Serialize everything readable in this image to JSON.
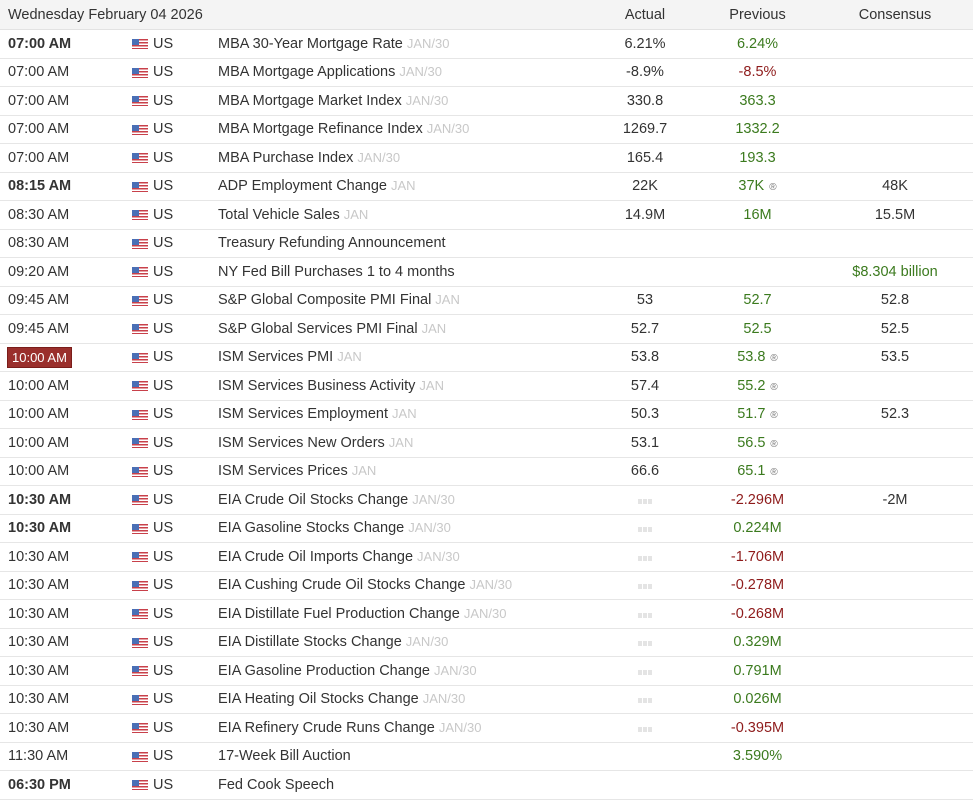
{
  "header": {
    "date": "Wednesday February 04 2026",
    "actual": "Actual",
    "previous": "Previous",
    "consensus": "Consensus"
  },
  "colors": {
    "positive": "#3b7a1e",
    "negative": "#8e1b1b",
    "highlight": "#9a2f2c"
  },
  "revised_icon": "®",
  "rows": [
    {
      "time": "07:00 AM",
      "bold": true,
      "country": "US",
      "event": "MBA 30-Year Mortgage Rate",
      "period": "JAN/30",
      "actual": "6.21%",
      "previous": "6.24%",
      "prev_color": "green",
      "consensus": ""
    },
    {
      "time": "07:00 AM",
      "country": "US",
      "event": "MBA Mortgage Applications",
      "period": "JAN/30",
      "actual": "-8.9%",
      "previous": "-8.5%",
      "prev_color": "red",
      "consensus": ""
    },
    {
      "time": "07:00 AM",
      "country": "US",
      "event": "MBA Mortgage Market Index",
      "period": "JAN/30",
      "actual": "330.8",
      "previous": "363.3",
      "prev_color": "green",
      "consensus": ""
    },
    {
      "time": "07:00 AM",
      "country": "US",
      "event": "MBA Mortgage Refinance Index",
      "period": "JAN/30",
      "actual": "1269.7",
      "previous": "1332.2",
      "prev_color": "green",
      "consensus": ""
    },
    {
      "time": "07:00 AM",
      "country": "US",
      "event": "MBA Purchase Index",
      "period": "JAN/30",
      "actual": "165.4",
      "previous": "193.3",
      "prev_color": "green",
      "consensus": ""
    },
    {
      "time": "08:15 AM",
      "bold": true,
      "country": "US",
      "event": "ADP Employment Change",
      "period": "JAN",
      "actual": "22K",
      "previous": "37K",
      "prev_color": "green",
      "revised": true,
      "consensus": "48K"
    },
    {
      "time": "08:30 AM",
      "country": "US",
      "event": "Total Vehicle Sales",
      "period": "JAN",
      "actual": "14.9M",
      "previous": "16M",
      "prev_color": "green",
      "consensus": "15.5M"
    },
    {
      "time": "08:30 AM",
      "country": "US",
      "event": "Treasury Refunding Announcement",
      "period": "",
      "actual": "",
      "previous": "",
      "consensus": ""
    },
    {
      "time": "09:20 AM",
      "country": "US",
      "event": "NY Fed Bill Purchases 1 to 4 months",
      "period": "",
      "actual": "",
      "previous": "",
      "consensus": "$8.304 billion",
      "cons_color": "green"
    },
    {
      "time": "09:45 AM",
      "country": "US",
      "event": "S&P Global Composite PMI Final",
      "period": "JAN",
      "actual": "53",
      "previous": "52.7",
      "prev_color": "green",
      "consensus": "52.8"
    },
    {
      "time": "09:45 AM",
      "country": "US",
      "event": "S&P Global Services PMI Final",
      "period": "JAN",
      "actual": "52.7",
      "previous": "52.5",
      "prev_color": "green",
      "consensus": "52.5"
    },
    {
      "time": "10:00 AM",
      "highlight": true,
      "country": "US",
      "event": "ISM Services PMI",
      "period": "JAN",
      "actual": "53.8",
      "previous": "53.8",
      "prev_color": "green",
      "revised": true,
      "consensus": "53.5"
    },
    {
      "time": "10:00 AM",
      "country": "US",
      "event": "ISM Services Business Activity",
      "period": "JAN",
      "actual": "57.4",
      "previous": "55.2",
      "prev_color": "green",
      "revised": true,
      "consensus": ""
    },
    {
      "time": "10:00 AM",
      "country": "US",
      "event": "ISM Services Employment",
      "period": "JAN",
      "actual": "50.3",
      "previous": "51.7",
      "prev_color": "green",
      "revised": true,
      "consensus": "52.3"
    },
    {
      "time": "10:00 AM",
      "country": "US",
      "event": "ISM Services New Orders",
      "period": "JAN",
      "actual": "53.1",
      "previous": "56.5",
      "prev_color": "green",
      "revised": true,
      "consensus": ""
    },
    {
      "time": "10:00 AM",
      "country": "US",
      "event": "ISM Services Prices",
      "period": "JAN",
      "actual": "66.6",
      "previous": "65.1",
      "prev_color": "green",
      "revised": true,
      "consensus": ""
    },
    {
      "time": "10:30 AM",
      "bold": true,
      "country": "US",
      "event": "EIA Crude Oil Stocks Change",
      "period": "JAN/30",
      "pending": true,
      "actual": "",
      "previous": "-2.296M",
      "prev_color": "red",
      "consensus": "-2M"
    },
    {
      "time": "10:30 AM",
      "bold": true,
      "country": "US",
      "event": "EIA Gasoline Stocks Change",
      "period": "JAN/30",
      "pending": true,
      "actual": "",
      "previous": "0.224M",
      "prev_color": "green",
      "consensus": ""
    },
    {
      "time": "10:30 AM",
      "country": "US",
      "event": "EIA Crude Oil Imports Change",
      "period": "JAN/30",
      "pending": true,
      "actual": "",
      "previous": "-1.706M",
      "prev_color": "red",
      "consensus": ""
    },
    {
      "time": "10:30 AM",
      "country": "US",
      "event": "EIA Cushing Crude Oil Stocks Change",
      "period": "JAN/30",
      "pending": true,
      "actual": "",
      "previous": "-0.278M",
      "prev_color": "red",
      "consensus": ""
    },
    {
      "time": "10:30 AM",
      "country": "US",
      "event": "EIA Distillate Fuel Production Change",
      "period": "JAN/30",
      "pending": true,
      "actual": "",
      "previous": "-0.268M",
      "prev_color": "red",
      "consensus": ""
    },
    {
      "time": "10:30 AM",
      "country": "US",
      "event": "EIA Distillate Stocks Change",
      "period": "JAN/30",
      "pending": true,
      "actual": "",
      "previous": "0.329M",
      "prev_color": "green",
      "consensus": ""
    },
    {
      "time": "10:30 AM",
      "country": "US",
      "event": "EIA Gasoline Production Change",
      "period": "JAN/30",
      "pending": true,
      "actual": "",
      "previous": "0.791M",
      "prev_color": "green",
      "consensus": ""
    },
    {
      "time": "10:30 AM",
      "country": "US",
      "event": "EIA Heating Oil Stocks Change",
      "period": "JAN/30",
      "pending": true,
      "actual": "",
      "previous": "0.026M",
      "prev_color": "green",
      "consensus": ""
    },
    {
      "time": "10:30 AM",
      "country": "US",
      "event": "EIA Refinery Crude Runs Change",
      "period": "JAN/30",
      "pending": true,
      "actual": "",
      "previous": "-0.395M",
      "prev_color": "red",
      "consensus": ""
    },
    {
      "time": "11:30 AM",
      "country": "US",
      "event": "17-Week Bill Auction",
      "period": "",
      "actual": "",
      "previous": "3.590%",
      "prev_color": "green",
      "consensus": ""
    },
    {
      "time": "06:30 PM",
      "bold": true,
      "country": "US",
      "event": "Fed Cook Speech",
      "period": "",
      "actual": "",
      "previous": "",
      "consensus": ""
    }
  ]
}
